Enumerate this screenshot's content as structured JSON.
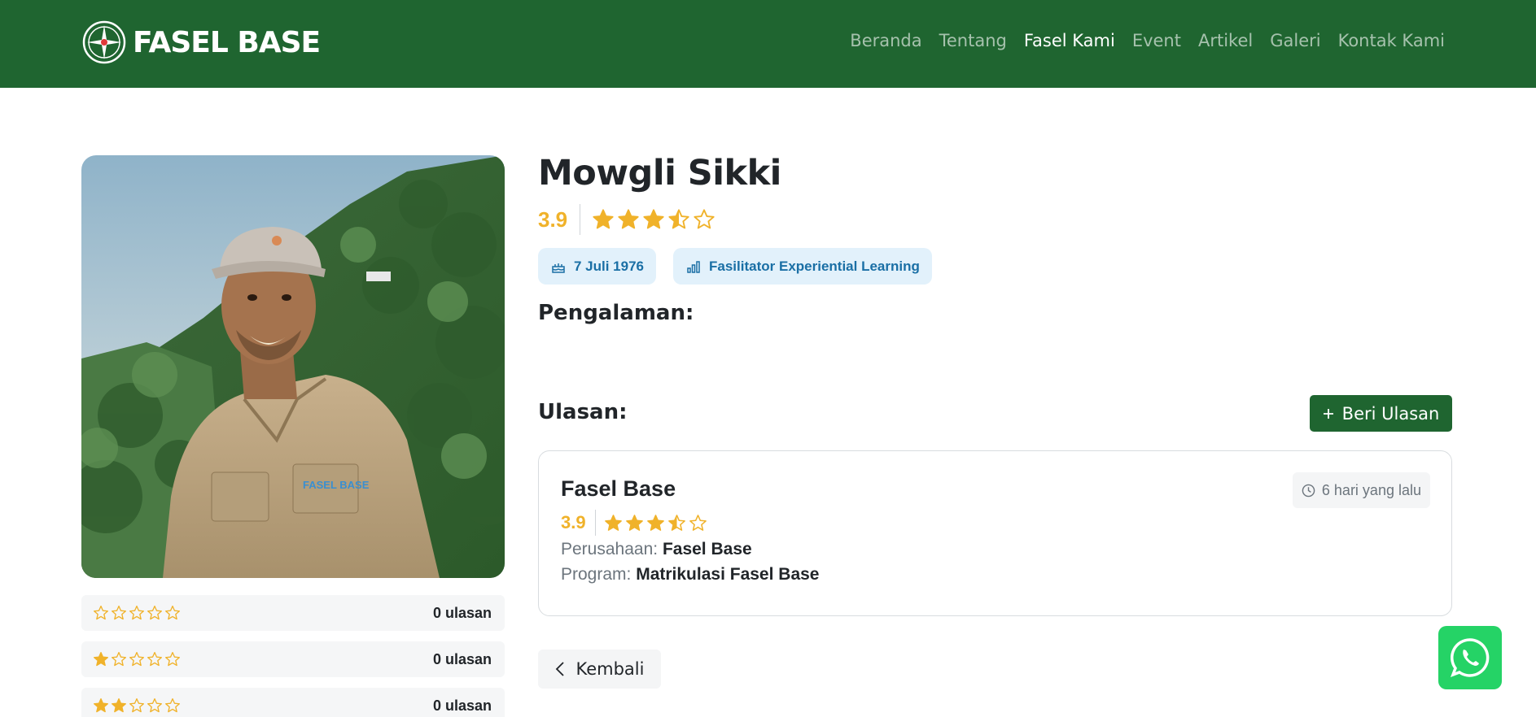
{
  "colors": {
    "brand_green": "#1f6530",
    "star": "#f0b22a",
    "badge_bg": "#e2f1fb",
    "badge_text": "#1a6fa5",
    "whatsapp": "#25d366"
  },
  "brand": {
    "name": "FASEL BASE",
    "logo_icon": "compass-icon"
  },
  "nav": [
    {
      "label": "Beranda",
      "active": false
    },
    {
      "label": "Tentang",
      "active": false
    },
    {
      "label": "Fasel Kami",
      "active": true
    },
    {
      "label": "Event",
      "active": false
    },
    {
      "label": "Artikel",
      "active": false
    },
    {
      "label": "Galeri",
      "active": false
    },
    {
      "label": "Kontak Kami",
      "active": false
    }
  ],
  "profile": {
    "name": "Mowgli Sikki",
    "rating": "3.9",
    "stars": 3.5,
    "birthdate": "7 Juli 1976",
    "birthdate_icon": "cake-icon",
    "role": "Fasilitator Experiential Learning",
    "role_icon": "bar-chart-icon",
    "photo_shirt_logo": "FASEL BASE"
  },
  "distribution": [
    {
      "stars": 0,
      "count_text": "0 ulasan"
    },
    {
      "stars": 1,
      "count_text": "0 ulasan"
    },
    {
      "stars": 2,
      "count_text": "0 ulasan"
    }
  ],
  "sections": {
    "experience_title": "Pengalaman:",
    "reviews_title": "Ulasan:"
  },
  "actions": {
    "review_button": "Beri Ulasan",
    "review_button_icon": "plus-icon",
    "back_button": "Kembali",
    "back_icon": "chevron-left-icon",
    "whatsapp_icon": "whatsapp-icon"
  },
  "review": {
    "author": "Fasel Base",
    "time": "6 hari yang lalu",
    "time_icon": "clock-icon",
    "rating": "3.9",
    "stars": 3.5,
    "company_label": "Perusahaan:",
    "company": "Fasel Base",
    "program_label": "Program:",
    "program": "Matrikulasi Fasel Base"
  }
}
